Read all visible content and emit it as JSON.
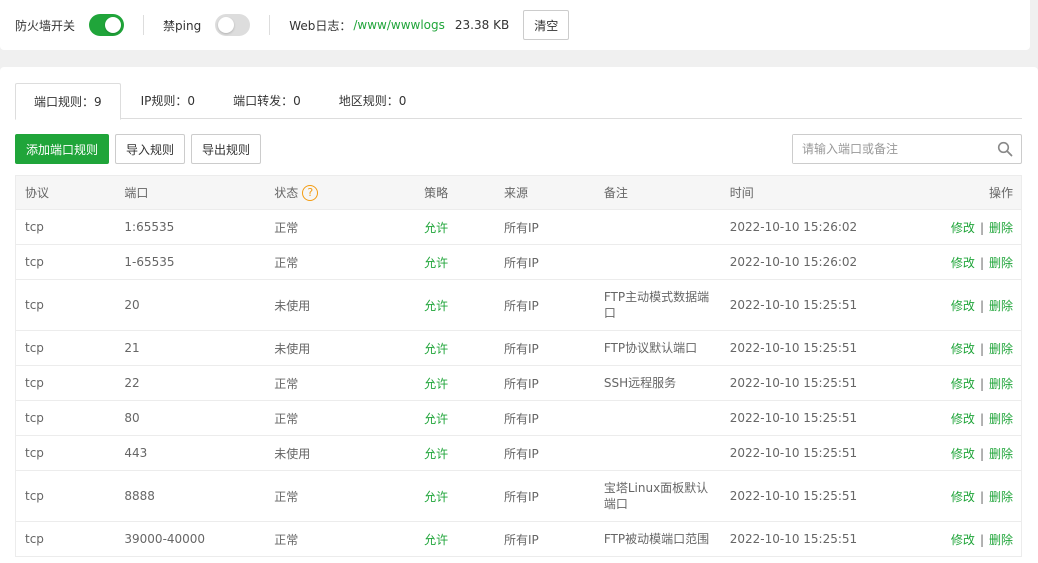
{
  "top": {
    "firewall_label": "防火墙开关",
    "firewall_on": true,
    "ping_label": "禁ping",
    "ping_on": false,
    "log_label": "Web日志：",
    "log_path": "/www/wwwlogs",
    "log_size": "23.38 KB",
    "clear_label": "清空"
  },
  "tabs": [
    {
      "label": "端口规则：9",
      "active": true
    },
    {
      "label": "IP规则：0",
      "active": false
    },
    {
      "label": "端口转发：0",
      "active": false
    },
    {
      "label": "地区规则：0",
      "active": false
    }
  ],
  "toolbar": {
    "add_label": "添加端口规则",
    "import_label": "导入规则",
    "export_label": "导出规则",
    "search_placeholder": "请输入端口或备注"
  },
  "table": {
    "headers": [
      "协议",
      "端口",
      "状态",
      "策略",
      "来源",
      "备注",
      "时间",
      "操作"
    ],
    "edit_label": "修改",
    "op_sep": "|",
    "delete_label": "删除",
    "rows": [
      {
        "protocol": "tcp",
        "port": "1:65535",
        "status": "正常",
        "policy": "允许",
        "source": "所有IP",
        "note": "",
        "time": "2022-10-10 15:26:02"
      },
      {
        "protocol": "tcp",
        "port": "1-65535",
        "status": "正常",
        "policy": "允许",
        "source": "所有IP",
        "note": "",
        "time": "2022-10-10 15:26:02"
      },
      {
        "protocol": "tcp",
        "port": "20",
        "status": "未使用",
        "policy": "允许",
        "source": "所有IP",
        "note": "FTP主动模式数据端口",
        "time": "2022-10-10 15:25:51"
      },
      {
        "protocol": "tcp",
        "port": "21",
        "status": "未使用",
        "policy": "允许",
        "source": "所有IP",
        "note": "FTP协议默认端口",
        "time": "2022-10-10 15:25:51"
      },
      {
        "protocol": "tcp",
        "port": "22",
        "status": "正常",
        "policy": "允许",
        "source": "所有IP",
        "note": "SSH远程服务",
        "time": "2022-10-10 15:25:51"
      },
      {
        "protocol": "tcp",
        "port": "80",
        "status": "正常",
        "policy": "允许",
        "source": "所有IP",
        "note": "",
        "time": "2022-10-10 15:25:51"
      },
      {
        "protocol": "tcp",
        "port": "443",
        "status": "未使用",
        "policy": "允许",
        "source": "所有IP",
        "note": "",
        "time": "2022-10-10 15:25:51"
      },
      {
        "protocol": "tcp",
        "port": "8888",
        "status": "正常",
        "policy": "允许",
        "source": "所有IP",
        "note": "宝塔Linux面板默认端口",
        "time": "2022-10-10 15:25:51"
      },
      {
        "protocol": "tcp",
        "port": "39000-40000",
        "status": "正常",
        "policy": "允许",
        "source": "所有IP",
        "note": "FTP被动模端口范围",
        "time": "2022-10-10 15:25:51"
      }
    ]
  },
  "colors": {
    "accent": "#20a53a",
    "help": "#f39c12"
  },
  "icons": {
    "help": "?"
  }
}
